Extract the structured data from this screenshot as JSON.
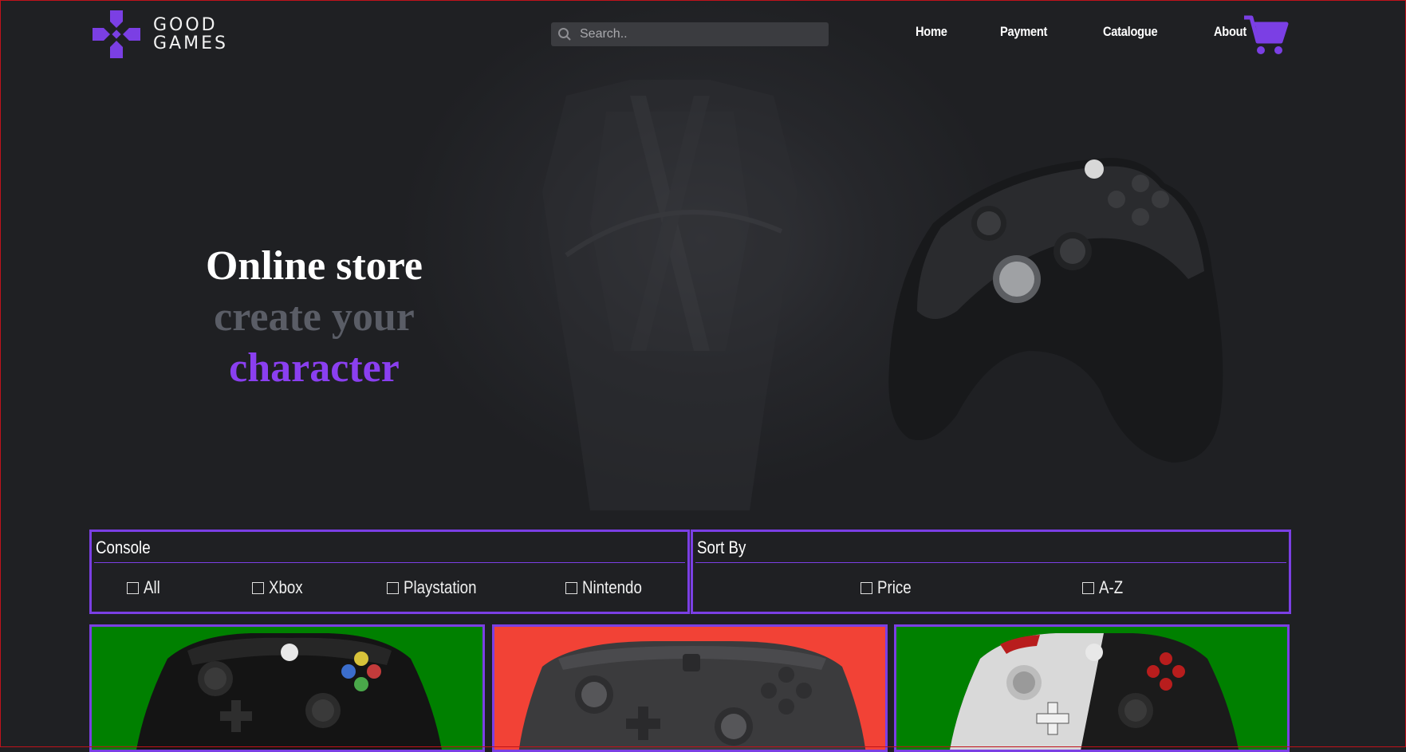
{
  "brand": {
    "line1": "GOOD",
    "line2": "GAMES",
    "logo_color": "#7b3fe4"
  },
  "search": {
    "placeholder": "Search.."
  },
  "nav": {
    "items": [
      "Home",
      "Payment",
      "Catalogue",
      "About"
    ]
  },
  "icons": {
    "cart": "cart-icon",
    "search": "search-icon",
    "logo": "gamepad-cross-icon"
  },
  "hero": {
    "line1": "Online store",
    "line2": "create your",
    "line3": "character"
  },
  "filters": {
    "console": {
      "title": "Console",
      "options": [
        "All",
        "Xbox",
        "Playstation",
        "Nintendo"
      ]
    },
    "sort": {
      "title": "Sort By",
      "options": [
        "Price",
        "A-Z"
      ]
    }
  },
  "products": [
    {
      "name": "xbox-one-controller",
      "bg": "#008000"
    },
    {
      "name": "switch-pro-controller",
      "bg": "#f24236"
    },
    {
      "name": "xbox-cyberpunk-controller",
      "bg": "#008000"
    }
  ],
  "colors": {
    "accent": "#7b3fe4",
    "background": "#1f2023"
  }
}
